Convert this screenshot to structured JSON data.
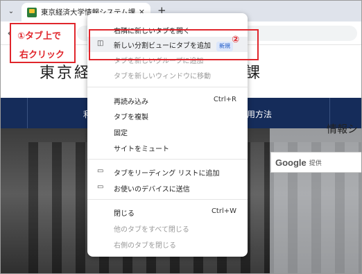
{
  "browser": {
    "tab_title": "東京経済大学情報システム課",
    "tab_close": "✕",
    "new_tab": "+",
    "dropdown": "⌄",
    "back": "←"
  },
  "site": {
    "title_left": "東京経",
    "title_right": "課",
    "nav_items": [
      "利",
      "用方法"
    ],
    "hero_heading": "情報シ",
    "search_logo": "Google",
    "search_sub": "提供"
  },
  "annotations": {
    "step1_line1": "①タブ上で",
    "step1_line2": "右クリック",
    "step2": "②"
  },
  "context_menu": {
    "items": [
      {
        "label": "右隣に新しいタブを開く",
        "shortcut": "",
        "icon": "",
        "disabled": false
      },
      {
        "label": "新しい分割ビューにタブを追加",
        "shortcut": "",
        "icon": "split-view",
        "badge": "新規",
        "disabled": false
      },
      {
        "label": "タブを新しいグループに追加",
        "shortcut": "",
        "icon": "",
        "disabled": true
      },
      {
        "label": "タブを新しいウィンドウに移動",
        "shortcut": "",
        "icon": "",
        "disabled": true
      },
      {
        "label": "再読み込み",
        "shortcut": "Ctrl+R",
        "icon": "",
        "disabled": false
      },
      {
        "label": "タブを複製",
        "shortcut": "",
        "icon": "",
        "disabled": false
      },
      {
        "label": "固定",
        "shortcut": "",
        "icon": "",
        "disabled": false
      },
      {
        "label": "サイトをミュート",
        "shortcut": "",
        "icon": "",
        "disabled": false
      },
      {
        "label": "タブをリーディング リストに追加",
        "shortcut": "",
        "icon": "reading-list",
        "disabled": false
      },
      {
        "label": "お使いのデバイスに送信",
        "shortcut": "",
        "icon": "devices",
        "disabled": false
      },
      {
        "label": "閉じる",
        "shortcut": "Ctrl+W",
        "icon": "",
        "disabled": false
      },
      {
        "label": "他のタブをすべて閉じる",
        "shortcut": "",
        "icon": "",
        "disabled": true
      },
      {
        "label": "右側のタブを閉じる",
        "shortcut": "",
        "icon": "",
        "disabled": true
      }
    ]
  },
  "colors": {
    "annotation_red": "#e0252b",
    "nav_blue": "#152c5a",
    "badge_blue": "#1a56c4"
  }
}
